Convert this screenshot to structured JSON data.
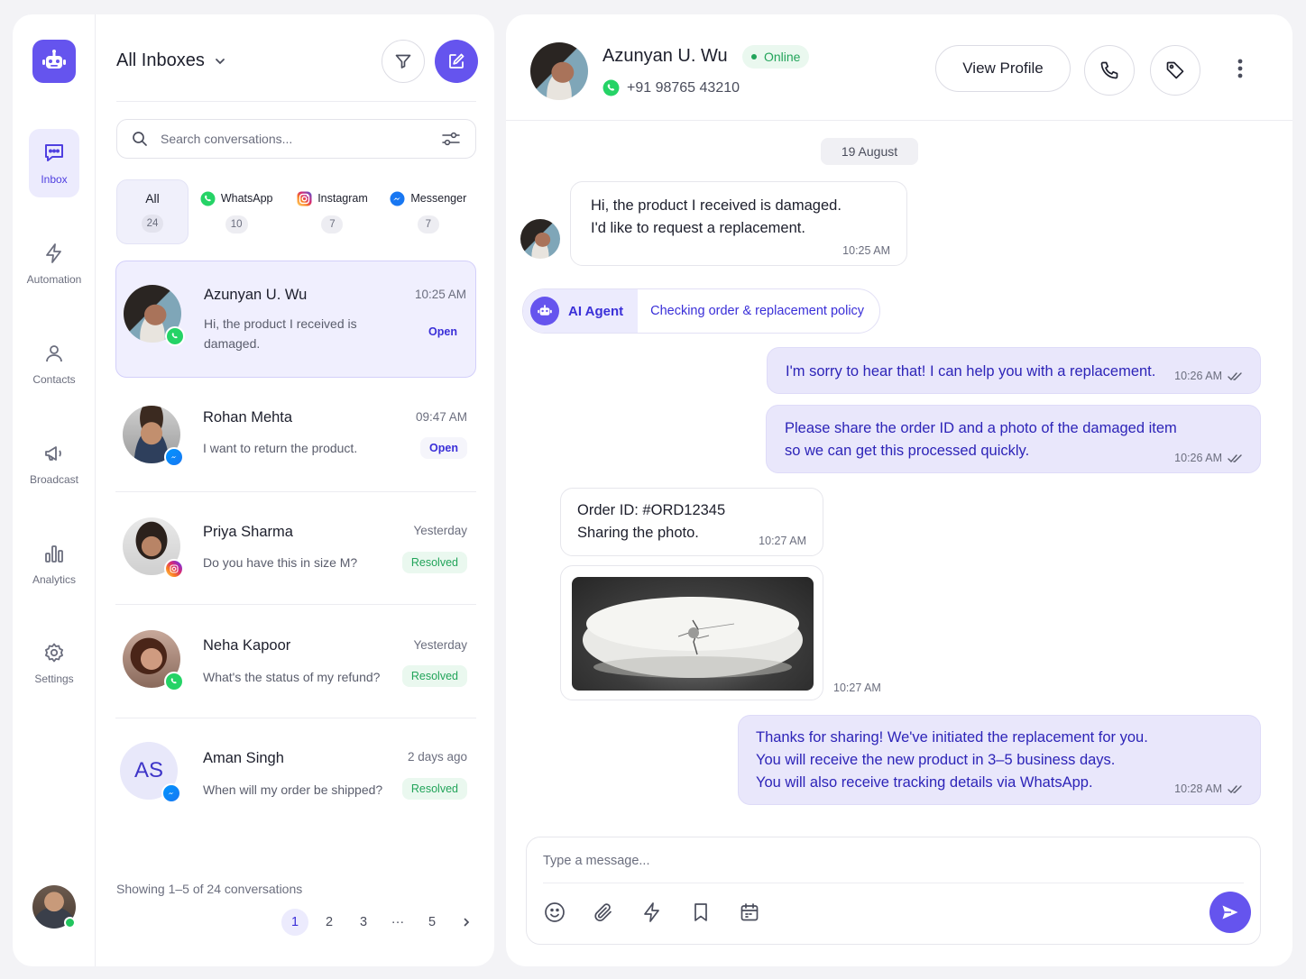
{
  "colors": {
    "accent": "#6554ee",
    "accent_text": "#3a2fd8",
    "online": "#22a45a",
    "whatsapp": "#25d366"
  },
  "nav": {
    "items": [
      {
        "label": "Inbox",
        "icon": "chat-bubble-icon"
      },
      {
        "label": "Automation",
        "icon": "lightning-icon"
      },
      {
        "label": "Contacts",
        "icon": "person-icon"
      },
      {
        "label": "Broadcast",
        "icon": "megaphone-icon"
      },
      {
        "label": "Analytics",
        "icon": "bar-chart-icon"
      },
      {
        "label": "Settings",
        "icon": "gear-icon"
      }
    ]
  },
  "list": {
    "title": "All Inboxes",
    "search_placeholder": "Search conversations...",
    "tabs": [
      {
        "label": "All",
        "count": "24"
      },
      {
        "label": "WhatsApp",
        "count": "10"
      },
      {
        "label": "Instagram",
        "count": "7"
      },
      {
        "label": "Messenger",
        "count": "7"
      }
    ],
    "conversations": [
      {
        "name": "Azunyan U. Wu",
        "time": "10:25 AM",
        "preview": "Hi, the product I received is damaged.",
        "status": "Open",
        "channel": "whatsapp"
      },
      {
        "name": "Rohan Mehta",
        "time": "09:47 AM",
        "preview": "I want to return the product.",
        "status": "Open",
        "channel": "messenger"
      },
      {
        "name": "Priya Sharma",
        "time": "Yesterday",
        "preview": "Do you have this in size M?",
        "status": "Resolved",
        "channel": "instagram"
      },
      {
        "name": "Neha Kapoor",
        "time": "Yesterday",
        "preview": "What's the status of my refund?",
        "status": "Resolved",
        "channel": "whatsapp"
      },
      {
        "name": "Aman Singh",
        "time": "2 days ago",
        "preview": "When will my order be shipped?",
        "status": "Resolved",
        "channel": "messenger",
        "initials": "AS"
      }
    ],
    "showing": "Showing 1–5 of 24 conversations",
    "pages": [
      "1",
      "2",
      "3",
      "···",
      "5"
    ]
  },
  "chat": {
    "contact_name": "Azunyan U. Wu",
    "presence": "Online",
    "phone": "+91 98765 43210",
    "view_profile": "View Profile",
    "date_divider": "19 August",
    "messages": [
      {
        "dir": "in",
        "line1": "Hi, the product I received is damaged.",
        "line2": "I'd like to request a replacement.",
        "time": "10:25 AM"
      },
      {
        "dir": "out",
        "line1": "I'm sorry to hear that! I can help you with a replacement.",
        "time": "10:26 AM"
      },
      {
        "dir": "out",
        "line1": "Please share the order ID and a photo of the damaged item",
        "line2": "so we can get this processed quickly.",
        "time": "10:26 AM"
      },
      {
        "dir": "in",
        "line1": "Order ID: #ORD12345",
        "line2": "Sharing the photo.",
        "time": "10:27 AM"
      },
      {
        "dir": "in",
        "type": "image",
        "time": "10:27 AM"
      },
      {
        "dir": "out",
        "line1": "Thanks for sharing! We've initiated the replacement for you.",
        "line2": "You will receive the new product in 3–5 business days.",
        "line3": "You will also receive tracking details via WhatsApp.",
        "time": "10:28 AM"
      }
    ],
    "ai_agent": {
      "label": "AI Agent",
      "status": "Checking order & replacement policy"
    },
    "composer_placeholder": "Type a message...",
    "tools": [
      "emoji-icon",
      "paperclip-icon",
      "lightning-icon",
      "bookmark-icon",
      "calendar-icon"
    ]
  }
}
